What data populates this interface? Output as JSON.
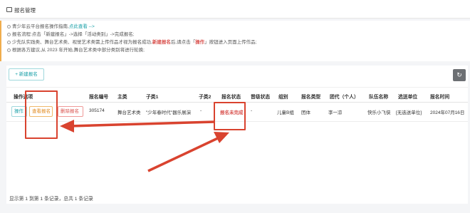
{
  "header": {
    "icon": "monitor-icon",
    "title": "报名管理"
  },
  "notice": {
    "line1_text": "青少年云平台报名操作指南,",
    "line1_link": "点此查看 -->",
    "line2_text": "报名流程:点击「新建报名」->选择「活动类别」->完成报名;",
    "line3_a": "少先队实践类、舞台艺术类、视觉艺术类需上传作品才视为报名成功,",
    "line3_red": "新建报名",
    "line3_b": "后,请点击「",
    "line3_red2": "操作",
    "line3_c": "」按钮进入页面上传作品;",
    "line4_text": "根据各方建议,从 2023 年开始,舞台艺术类中部分类别将进行轮换;"
  },
  "toolbar": {
    "new_label": "+ 新建报名",
    "refresh_icon": "refresh-icon"
  },
  "table": {
    "headers": [
      "操作选项",
      "报名编号",
      "主类",
      "子类1",
      "子类2",
      "报名状态",
      "晋级状态",
      "组别",
      "报名类型",
      "团代（个人）",
      "队伍名称",
      "选送单位",
      "报名时间"
    ],
    "row": {
      "op_label": "操作",
      "view_label": "查看报名",
      "delete_label": "删除报名",
      "id": "305174",
      "main_category": "舞台艺术类",
      "sub1": "\"少年春时代\"器乐展演",
      "sub2": "-",
      "status": "报名未完成",
      "promotion": "-",
      "group": "儿童B组",
      "type": "团体",
      "representative": "李一凉",
      "team": "快乐小飞侠",
      "unit": "[无选送单位]",
      "time": "2024年07月16日"
    }
  },
  "footer": {
    "summary": "显示第 1 到第 1 条记录，总共 1 条记录"
  },
  "colors": {
    "accent": "#1aa0a8",
    "warning": "#e08a1f",
    "danger": "#d9534f",
    "annotation": "#d9432f"
  }
}
